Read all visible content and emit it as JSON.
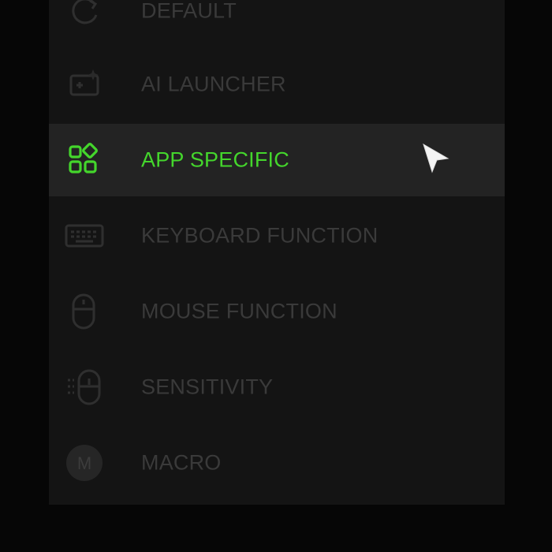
{
  "menu": {
    "items": [
      {
        "label": "DEFAULT",
        "icon": "refresh-icon",
        "active": false
      },
      {
        "label": "AI LAUNCHER",
        "icon": "ai-launcher-icon",
        "active": false
      },
      {
        "label": "APP SPECIFIC",
        "icon": "apps-grid-icon",
        "active": true
      },
      {
        "label": "KEYBOARD FUNCTION",
        "icon": "keyboard-icon",
        "active": false
      },
      {
        "label": "MOUSE FUNCTION",
        "icon": "mouse-icon",
        "active": false
      },
      {
        "label": "SENSITIVITY",
        "icon": "sensitivity-icon",
        "active": false
      },
      {
        "label": "MACRO",
        "icon": "macro-icon",
        "active": false
      }
    ]
  },
  "colors": {
    "accent": "#44d62c",
    "inactive_text": "#3a3a3a",
    "active_row_bg": "#232323",
    "panel_bg": "#141414",
    "page_bg": "#060606"
  },
  "macro_icon_glyph": "M"
}
